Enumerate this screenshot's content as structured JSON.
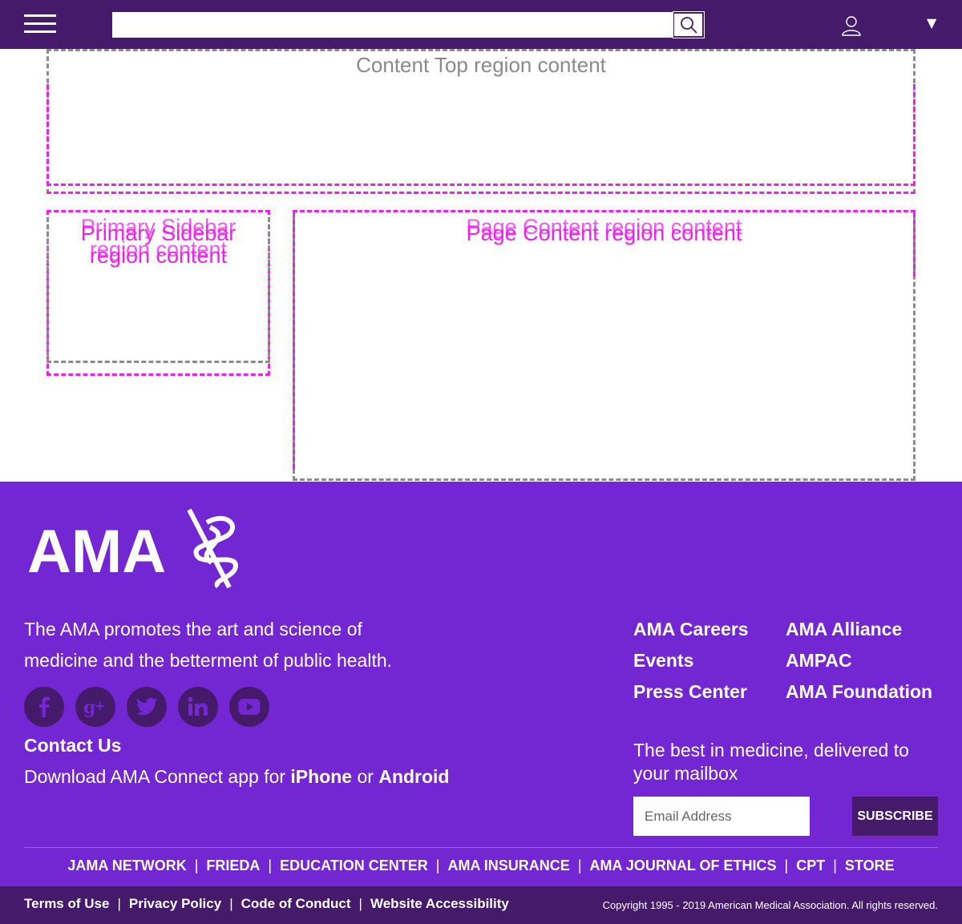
{
  "header": {
    "search_placeholder": "",
    "dropdown_glyph": "▼"
  },
  "regions": {
    "content_top": "Content Top region content",
    "primary_sidebar": "Primary Sidebar region content",
    "page_content": "Page Content region content"
  },
  "footer": {
    "logo_text": "AMA",
    "tagline": "The AMA promotes the art and science of medicine and the betterment of public health.",
    "links_left": [
      "AMA Careers",
      "Events",
      "Press Center"
    ],
    "links_right": [
      "AMA Alliance",
      "AMPAC",
      "AMA Foundation"
    ],
    "social": [
      "facebook-icon",
      "google-plus-icon",
      "twitter-icon",
      "linkedin-icon",
      "youtube-icon"
    ],
    "contact": "Contact Us",
    "download": {
      "prefix": "Download AMA Connect app for ",
      "iphone": "iPhone",
      "or": " or ",
      "android": "Android"
    },
    "newsletter": "The best in medicine, delivered to your mailbox",
    "email_placeholder": "Email Address",
    "subscribe_label": "SUBSCRIBE",
    "partners": [
      "JAMA NETWORK",
      "FRIEDA",
      "EDUCATION CENTER",
      "AMA INSURANCE",
      "AMA JOURNAL OF ETHICS",
      "CPT",
      "STORE"
    ],
    "legal": [
      "Terms of Use",
      "Privacy Policy",
      "Code of Conduct",
      "Website Accessibility"
    ],
    "copyright": "Copyright 1995 - 2019 American Medical Association. All rights reserved."
  },
  "colors": {
    "header_bg": "#451a6b",
    "footer_bg": "#7327d3",
    "region_pink": "#ee20ee",
    "region_gray": "#8c8c8c"
  }
}
